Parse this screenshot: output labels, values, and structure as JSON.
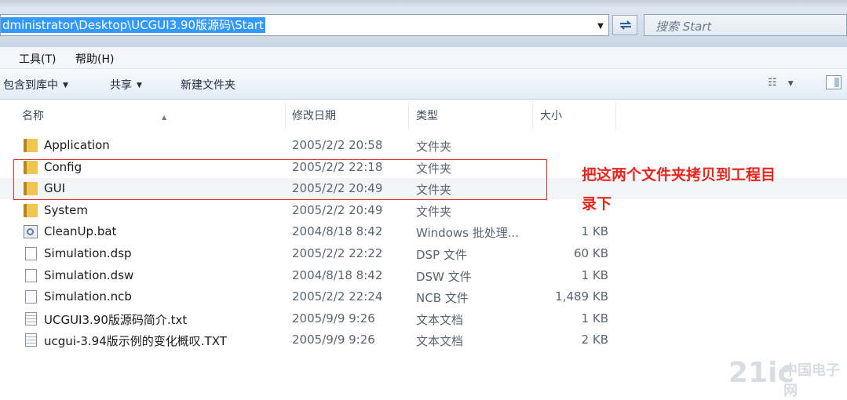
{
  "address": {
    "path": "dministrator\\Desktop\\UCGUI3.90版源码\\Start",
    "search_placeholder": "搜索 Start"
  },
  "menu": [
    "工具(T)",
    "帮助(H)"
  ],
  "toolbar": {
    "include_library": "包含到库中",
    "share": "共享",
    "new_folder": "新建文件夹"
  },
  "columns": [
    "名称",
    "修改日期",
    "类型",
    "大小"
  ],
  "files": [
    {
      "name": "Application",
      "date": "2005/2/2 20:58",
      "type": "文件夹",
      "size": "",
      "icon": "folder-icon"
    },
    {
      "name": "Config",
      "date": "2005/2/2 22:18",
      "type": "文件夹",
      "size": "",
      "icon": "folder-icon"
    },
    {
      "name": "GUI",
      "date": "2005/2/2 20:49",
      "type": "文件夹",
      "size": "",
      "icon": "folder-icon"
    },
    {
      "name": "System",
      "date": "2005/2/2 20:49",
      "type": "文件夹",
      "size": "",
      "icon": "folder-icon"
    },
    {
      "name": "CleanUp.bat",
      "date": "2004/8/18 8:42",
      "type": "Windows 批处理...",
      "size": "1 KB",
      "icon": "batch-file-icon"
    },
    {
      "name": "Simulation.dsp",
      "date": "2005/2/2 22:22",
      "type": "DSP 文件",
      "size": "60 KB",
      "icon": "file-icon"
    },
    {
      "name": "Simulation.dsw",
      "date": "2004/8/18 8:42",
      "type": "DSW 文件",
      "size": "1 KB",
      "icon": "file-icon"
    },
    {
      "name": "Simulation.ncb",
      "date": "2005/2/2 22:24",
      "type": "NCB 文件",
      "size": "1,489 KB",
      "icon": "file-icon"
    },
    {
      "name": "UCGUI3.90版源码简介.txt",
      "date": "2005/9/9 9:26",
      "type": "文本文档",
      "size": "1 KB",
      "icon": "text-file-icon"
    },
    {
      "name": "ucgui-3.94版示例的变化概叹.TXT",
      "date": "2005/9/9 9:26",
      "type": "文本文档",
      "size": "2 KB",
      "icon": "text-file-icon"
    }
  ],
  "annotation": {
    "line1": "把这两个文件夹拷贝到工程目",
    "line2": "录下",
    "color": "#e8261d"
  },
  "watermark": {
    "num": "21ic",
    "cn": "中国电子网"
  }
}
